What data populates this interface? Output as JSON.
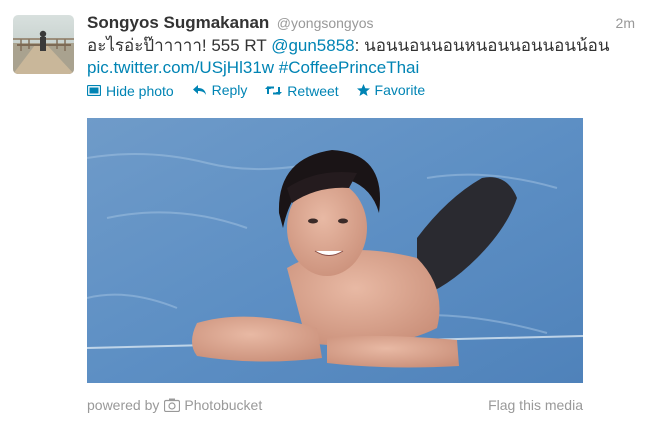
{
  "tweet": {
    "fullname": "Songyos Sugmakanan",
    "username": "@yongsongyos",
    "time": "2m",
    "text_part1": "อะไรอ่ะป๊าาาาา! 555 RT ",
    "mention": "@gun5858",
    "text_part2": ": นอนนอนนอนหนอนนอนนอนน้อน",
    "pic_link": "pic.twitter.com/USjHl31w",
    "hashtag": "#CoffeePrinceThai"
  },
  "actions": {
    "hide_photo": "Hide photo",
    "reply": "Reply",
    "retweet": "Retweet",
    "favorite": "Favorite"
  },
  "media_footer": {
    "powered_by": "powered by",
    "provider": "Photobucket",
    "flag": "Flag this media"
  },
  "colors": {
    "link": "#0084b4",
    "muted": "#999999",
    "text": "#333333"
  }
}
